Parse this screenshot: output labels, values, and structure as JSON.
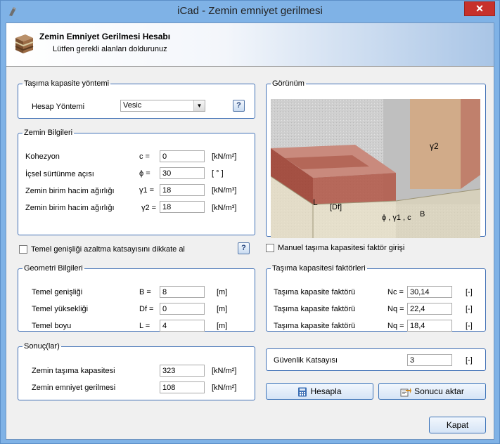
{
  "window": {
    "title": "iCad - Zemin emniyet gerilmesi",
    "close_label": "✕"
  },
  "header": {
    "title": "Zemin Emniyet Gerilmesi Hesabı",
    "subtitle": "Lütfen gerekli alanları doldurunuz"
  },
  "method_group": {
    "legend": "Taşıma kapasite yöntemi",
    "label": "Hesap Yöntemi",
    "selected": "Vesic",
    "help_label": "?"
  },
  "soil_group": {
    "legend": "Zemin Bilgileri",
    "rows": [
      {
        "label": "Kohezyon",
        "symbol": "c =",
        "value": "0",
        "unit": "[kN/m²]"
      },
      {
        "label": "İçsel sürtünme açısı",
        "symbol": "ϕ =",
        "value": "30",
        "unit": "[ ° ]"
      },
      {
        "label": "Zemin birim hacim ağırlığı",
        "symbol": "γ1 =",
        "value": "18",
        "unit": "[kN/m³]"
      },
      {
        "label": "Zemin birim hacim ağırlığı",
        "symbol": "γ2 =",
        "value": "18",
        "unit": "[kN/m³]"
      }
    ]
  },
  "width_reduction": {
    "label": "Temel genişliği azaltma katsayısını dikkate al",
    "checked": false,
    "help_label": "?"
  },
  "geometry_group": {
    "legend": "Geometri Bilgileri",
    "rows": [
      {
        "label": "Temel genişliği",
        "symbol": "B =",
        "value": "8",
        "unit": "[m]"
      },
      {
        "label": "Temel yüksekliği",
        "symbol": "Df =",
        "value": "0",
        "unit": "[m]"
      },
      {
        "label": "Temel boyu",
        "symbol": "L =",
        "value": "4",
        "unit": "[m]"
      }
    ]
  },
  "results_group": {
    "legend": "Sonuç(lar)",
    "rows": [
      {
        "label": "Zemin taşıma kapasitesi",
        "value": "323",
        "unit": "[kN/m²]"
      },
      {
        "label": "Zemin emniyet gerilmesi",
        "value": "108",
        "unit": "[kN/m²]"
      }
    ]
  },
  "view_group": {
    "legend": "Görünüm",
    "labels": {
      "gamma2": "γ2",
      "L": "L",
      "Df": "[Df]",
      "bottom": "ϕ , γ1 , c",
      "B": "B"
    }
  },
  "manual_factors": {
    "label": "Manuel taşıma kapasitesi faktör girişi",
    "checked": false
  },
  "factors_group": {
    "legend": "Taşıma kapasitesi faktörleri",
    "rows": [
      {
        "label": "Taşıma kapasite faktörü",
        "symbol": "Nc =",
        "value": "30,14",
        "unit": "[-]"
      },
      {
        "label": "Taşıma kapasite faktörü",
        "symbol": "Nq =",
        "value": "22,4",
        "unit": "[-]"
      },
      {
        "label": "Taşıma kapasite faktörü",
        "symbol": "Nq =",
        "value": "18,4",
        "unit": "[-]"
      }
    ]
  },
  "safety_group": {
    "label": "Güvenlik Katsayısı",
    "value": "3",
    "unit": "[-]"
  },
  "buttons": {
    "calculate": "Hesapla",
    "export": "Sonucu aktar",
    "close": "Kapat"
  },
  "colors": {
    "title_bar": "#7fb2e6",
    "group_border": "#3f6fb5",
    "close_button": "#c7312b"
  }
}
